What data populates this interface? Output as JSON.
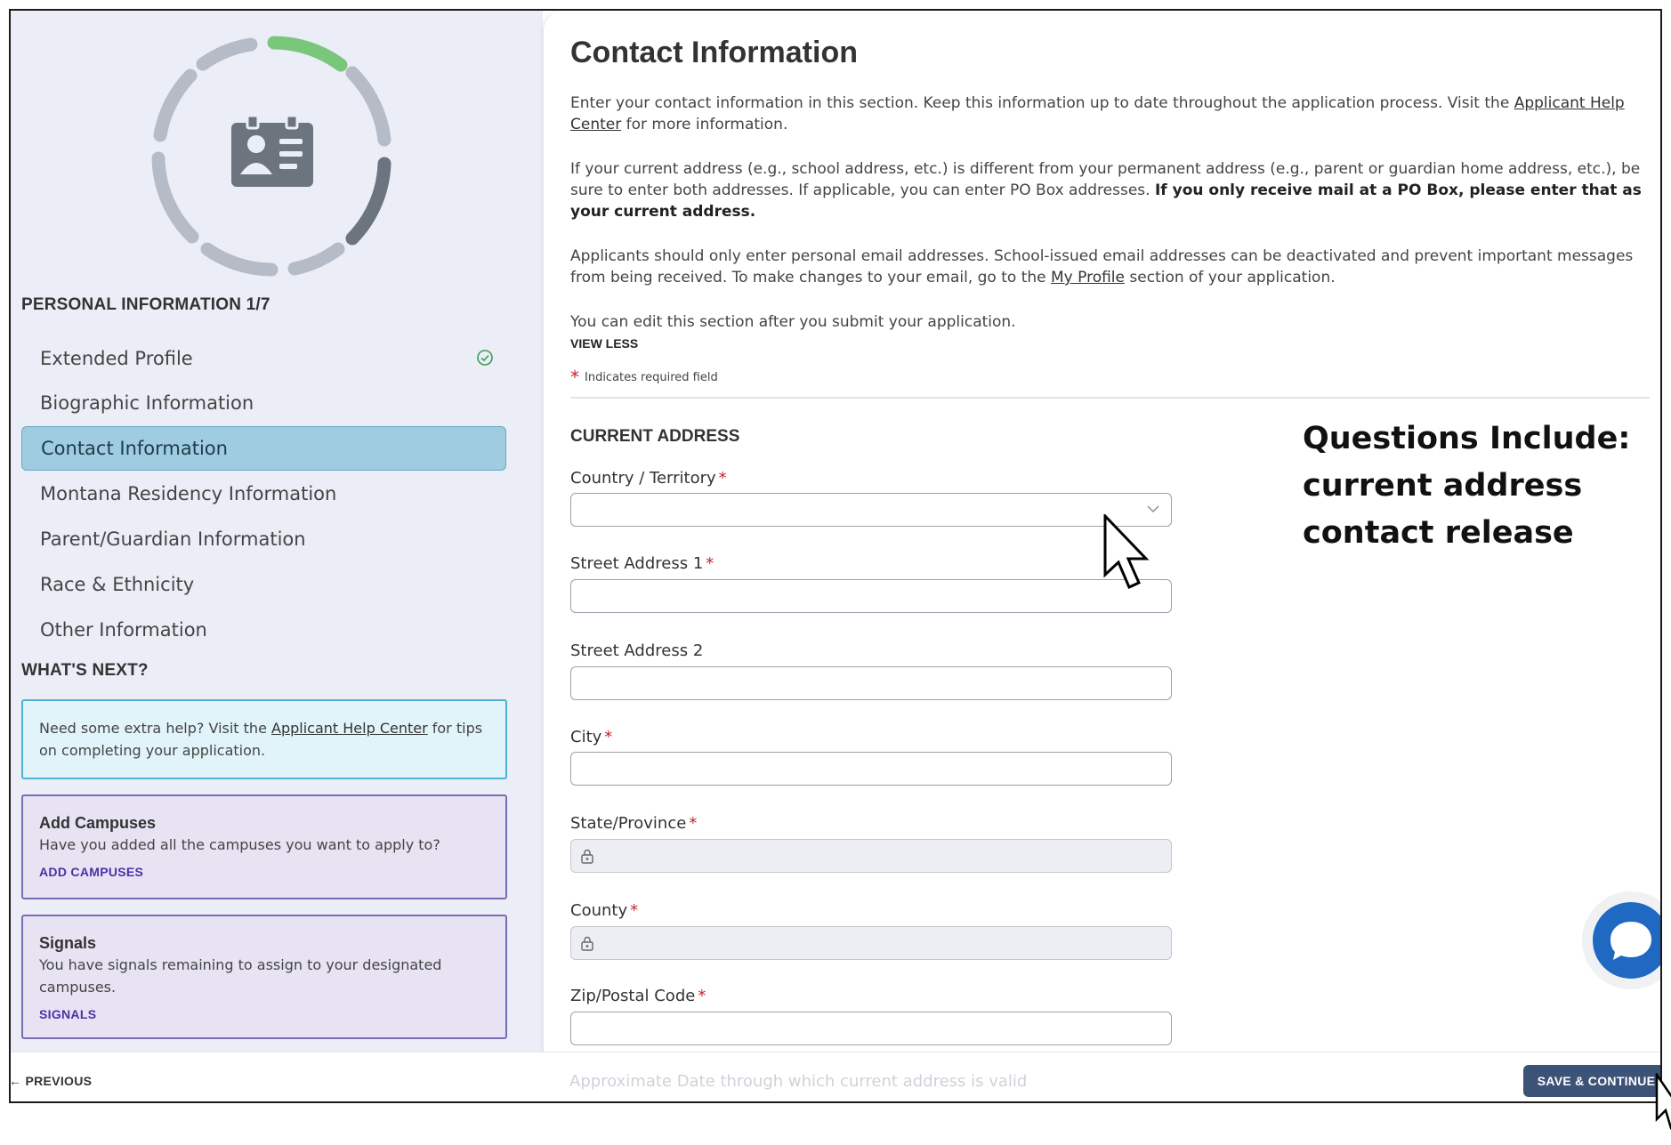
{
  "sidebar": {
    "section_title": "PERSONAL INFORMATION 1/7",
    "nav_items": [
      {
        "label": "Extended Profile",
        "completed": true
      },
      {
        "label": "Biographic Information"
      },
      {
        "label": "Contact Information",
        "active": true
      },
      {
        "label": "Montana Residency Information"
      },
      {
        "label": "Parent/Guardian Information"
      },
      {
        "label": "Race & Ethnicity"
      },
      {
        "label": "Other Information"
      }
    ],
    "whats_next_title": "WHAT'S NEXT?",
    "help_card": {
      "prefix": "Need some extra help? Visit the ",
      "link": "Applicant Help Center",
      "suffix": " for tips on completing your application."
    },
    "campuses_card": {
      "title": "Add Campuses",
      "text": "Have you added all the campuses you want to apply to?",
      "link": "ADD CAMPUSES"
    },
    "signals_card": {
      "title": "Signals",
      "text": "You have signals remaining to assign to your designated campuses.",
      "link": "SIGNALS"
    }
  },
  "main": {
    "title": "Contact Information",
    "para1": {
      "prefix": "Enter your contact information in this section. Keep this information up to date throughout the application process. Visit the ",
      "link": "Applicant Help Center",
      "suffix": " for more information."
    },
    "para2": {
      "text": "If your current address (e.g., school address, etc.) is different from your permanent address (e.g., parent or guardian home address, etc.), be sure to enter both addresses. If applicable, you can enter PO Box addresses. ",
      "bold": "If you only receive mail at a PO Box, please enter that as your current address."
    },
    "para3": {
      "prefix": "Applicants should only enter personal email addresses. School-issued email addresses can be deactivated and prevent important messages from being received. To make changes to your email, go to the ",
      "link": "My Profile",
      "suffix": " section of your application."
    },
    "para4": "You can edit this section after you submit your application.",
    "view_less": "VIEW LESS",
    "required_star": "*",
    "required_note": "Indicates required field",
    "current_address_title": "CURRENT ADDRESS",
    "fields": {
      "country": {
        "label": "Country / Territory",
        "value": ""
      },
      "street1": {
        "label": "Street Address 1",
        "value": ""
      },
      "street2": {
        "label": "Street Address 2",
        "value": ""
      },
      "city": {
        "label": "City",
        "value": ""
      },
      "state": {
        "label": "State/Province",
        "value": ""
      },
      "county": {
        "label": "County",
        "value": ""
      },
      "zip": {
        "label": "Zip/Postal Code",
        "value": ""
      }
    },
    "required_mark": "*",
    "faded_label": "Approximate Date through which current address is valid"
  },
  "annotation": {
    "line1": "Questions Include:",
    "line2": "current address",
    "line3": "contact release"
  },
  "footer": {
    "previous": "PREVIOUS",
    "save": "SAVE & CONTINUE"
  },
  "colors": {
    "active_nav": "#9fcce0",
    "save_button": "#3d5277",
    "chat_button": "#1f69c3",
    "progress_complete": "#79c77a",
    "required": "#c0262d"
  }
}
